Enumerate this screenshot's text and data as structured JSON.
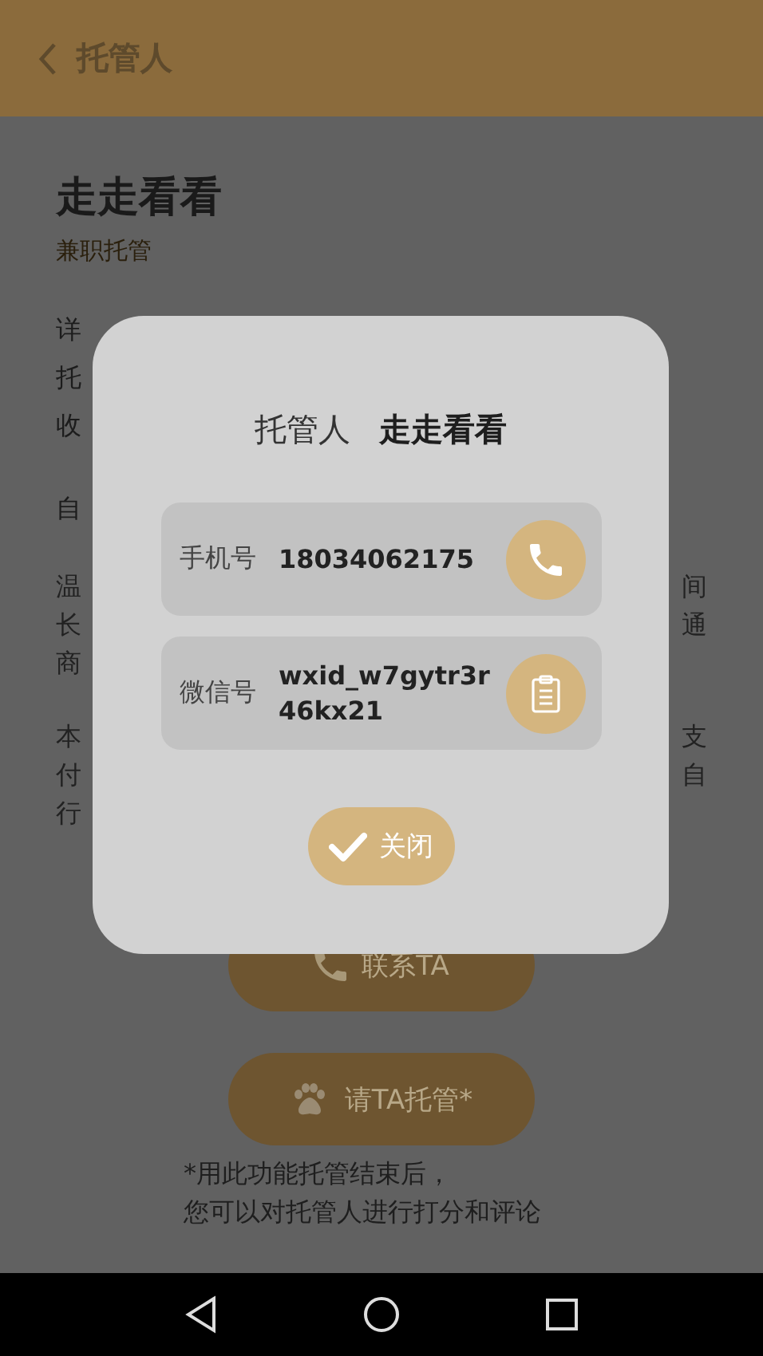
{
  "header": {
    "title": "托管人"
  },
  "profile": {
    "name": "走走看看",
    "type": "兼职托管"
  },
  "paragraphs": [
    {
      "lines": [
        {
          "start": "详"
        },
        {
          "start": "托"
        },
        {
          "start": "收"
        }
      ]
    },
    {
      "lines": [
        {
          "start": "自"
        }
      ]
    },
    {
      "lines": [
        {
          "start": "温",
          "end": "间"
        },
        {
          "start": "长",
          "end": "通"
        },
        {
          "start": "商"
        }
      ]
    },
    {
      "lines": [
        {
          "start": "本",
          "end": "支"
        },
        {
          "start": "付",
          "end": "自"
        },
        {
          "start": "行"
        }
      ]
    }
  ],
  "actions": [
    {
      "label": "联系TA",
      "kind": "call"
    },
    {
      "label": "请TA托管*",
      "kind": "hire"
    }
  ],
  "footnote": [
    "*用此功能托管结束后，",
    "您可以对托管人进行打分和评论"
  ],
  "dialog": {
    "label": "托管人",
    "name": "走走看看",
    "fields": [
      {
        "label": "手机号",
        "value": "18034062175",
        "kind": "phone"
      },
      {
        "label": "微信号",
        "value": "wxid_w7gytr3r46kx21",
        "kind": "wechat"
      }
    ],
    "close": "关闭"
  }
}
